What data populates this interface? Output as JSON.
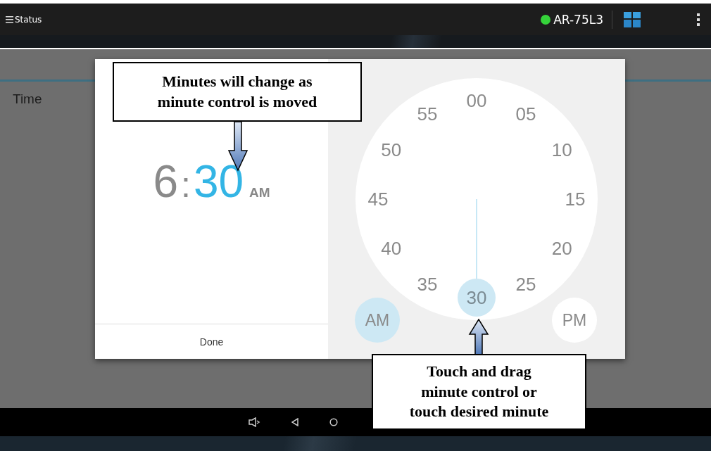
{
  "status_bar": {
    "title": "Status",
    "device": {
      "name": "AR-75L3",
      "connected": true
    }
  },
  "background": {
    "items": [
      {
        "label": "Time"
      }
    ]
  },
  "time_dialog": {
    "time": [
      {
        "kind": "hour",
        "text": "6",
        "selected": false
      },
      {
        "kind": "separator",
        "text": ":"
      },
      {
        "kind": "minute",
        "text": "30",
        "selected": true
      },
      {
        "kind": "period",
        "text": "AM"
      }
    ],
    "done_button": "Done",
    "dial": [
      {
        "label": "00",
        "selected": false
      },
      {
        "label": "05",
        "selected": false
      },
      {
        "label": "10",
        "selected": false
      },
      {
        "label": "15",
        "selected": false
      },
      {
        "label": "20",
        "selected": false
      },
      {
        "label": "25",
        "selected": false
      },
      {
        "label": "30",
        "selected": true
      },
      {
        "label": "35",
        "selected": false
      },
      {
        "label": "40",
        "selected": false
      },
      {
        "label": "45",
        "selected": false
      },
      {
        "label": "50",
        "selected": false
      },
      {
        "label": "55",
        "selected": false
      }
    ],
    "periods": [
      {
        "label": "AM",
        "selected": true
      },
      {
        "label": "PM",
        "selected": false
      }
    ]
  },
  "callouts": [
    {
      "text": "Minutes will change as minute control is moved",
      "kind": "down"
    },
    {
      "text": "Touch and drag minute control or touch desired minute",
      "kind": "up"
    }
  ]
}
